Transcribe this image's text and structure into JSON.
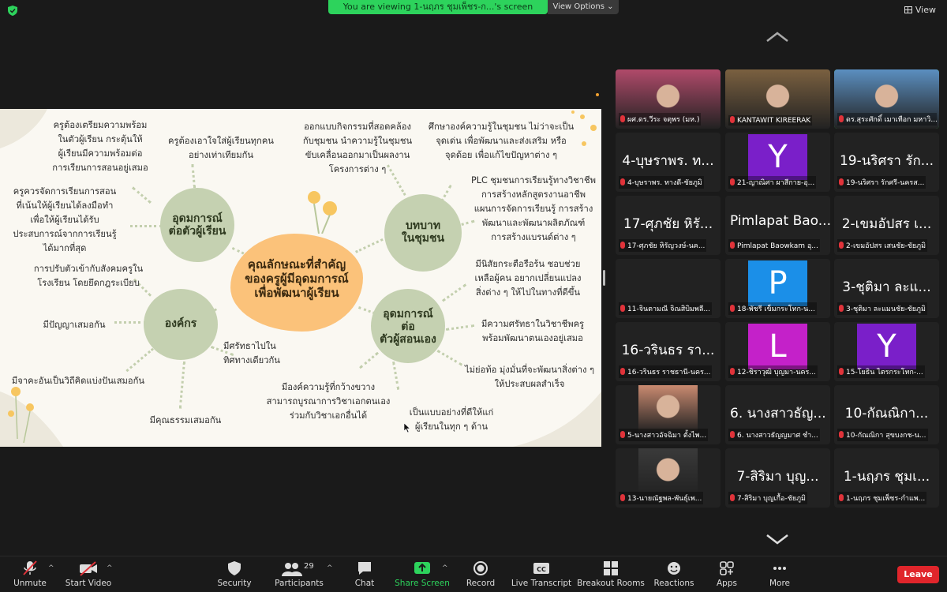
{
  "topbar": {
    "banner": "You are viewing 1-นฤภร ชุมเพ็ชร-ก...'s screen",
    "view_options": "View Options ⌄",
    "view": "View"
  },
  "slide": {
    "center": "คุณลักษณะที่สำคัญ\nของครูผู้มีอุดมการณ์\nเพื่อพัฒนาผู้เรียน",
    "blob_students": "อุดมการณ์\nต่อตัวผู้เรียน",
    "blob_community": "บทบาท\nในชุมชน",
    "blob_org": "องค์กร",
    "blob_self": "อุดมการณ์\nต่อ\nตัวผู้สอนเอง",
    "t1": "ครูต้องเตรียมความพร้อม\nในตัวผู้เรียน กระตุ้นให้\nผู้เรียนมีความพร้อมต่อ\nการเรียนการสอนอยู่เสมอ",
    "t2": "ครูต้องเอาใจใส่ผู้เรียนทุกคน\nอย่างเท่าเทียมกัน",
    "t3": "ครูควรจัดการเรียนการสอน\nที่เน้นให้ผู้เรียนได้ลงมือทำ\nเพื่อให้ผู้เรียนได้รับ\nประสบการณ์จากการเรียนรู้\nได้มากที่สุด",
    "t4": "ออกแบบกิจกรรมที่สอดคล้อง\nกับชุมชน นำความรู้ในชุมชน\nขับเคลื่อนออกมาเป็นผลงาน\nโครงการต่าง ๆ",
    "t5": "ศึกษาองค์ความรู้ในชุมชน ไม่ว่าจะเป็น\nจุดเด่น เพื่อพัฒนาและส่งเสริม หรือ\nจุดด้อย เพื่อแก้ไขปัญหาต่าง ๆ",
    "t6": "PLC ชุมชนการเรียนรู้ทางวิชาชีพ\nการสร้างหลักสูตรงานอาชีพ\nแผนการจัดการเรียนรู้ การสร้าง\nพัฒนาและพัฒนาผลิตภัณฑ์\nการสร้างแบรนด์ต่าง ๆ",
    "t7": "การปรับตัวเข้ากับสังคมครูใน\nโรงเรียน โดยยึดกฎระเบียบ",
    "t8": "มีปัญญาเสมอกัน",
    "t9": "มีศรัทธาไปใน\nทิศทางเดียวกัน",
    "t10": "มีจาคะอันเป็นวิถีคิดแบ่งปันเสมอกัน",
    "t11": "มีคุณธรรมเสมอกัน",
    "t12": "มีองค์ความรู้ที่กว้างขวาง\nสามารถบูรณาการวิชาเอกตนเอง\nร่วมกับวิชาเอกอื่นได้",
    "t13": "มีนิสัยกระตือรือร้น ชอบช่วย\nเหลือผู้คน อยากเปลี่ยนแปลง\nสิ่งต่าง ๆ ให้ไปในทางที่ดีขึ้น",
    "t14": "มีความศรัทธาในวิชาชีพครู\nพร้อมพัฒนาตนเองอยู่เสมอ",
    "t15": "ไม่ย่อท้อ มุ่งมั่นที่จะพัฒนาสิ่งต่าง ๆ\nให้ประสบผลสำเร็จ",
    "t16": "เป็นแบบอย่างที่ดีให้แก่\nผู้เรียนในทุก ๆ ด้าน"
  },
  "tiles": [
    {
      "big": "",
      "name": "ผศ.ดร.วีระ จตุพร (มห.)",
      "kind": "video",
      "color": "#b04a6a"
    },
    {
      "big": "",
      "name": "KANTAWIT KIREERAK",
      "kind": "video",
      "color": "#7a6040"
    },
    {
      "big": "",
      "name": "ดร.สุระศักดิ์ เมาเทือก มหาวิ...",
      "kind": "video",
      "color": "#5b8fc0"
    },
    {
      "big": "4-บุษราพร. ท...",
      "name": "4-บุษราพร. ทางดี-ชัยภูมิ",
      "kind": "text"
    },
    {
      "big": "Y",
      "name": "21-ญาณิศา ผาสีกาย-อุ...",
      "kind": "avatar",
      "color": "#7a1fc9"
    },
    {
      "big": "19-นริศรา รัก...",
      "name": "19-นริศรา รักศรี-นครส...",
      "kind": "text"
    },
    {
      "big": "17-ศุภชัย หิรั...",
      "name": "17-ศุภชัย หิรัญวงษ์-นค...",
      "kind": "text"
    },
    {
      "big": "Pimlapat Bao...",
      "name": "Pimlapat Baowkam อุ...",
      "kind": "text"
    },
    {
      "big": "2-เขมอัปสร เ...",
      "name": "2-เขมอัปสร เสนชัย-ชัยภูมิ",
      "kind": "text"
    },
    {
      "big": "",
      "name": "11-จินตามณี จิณสิบิมพลี...",
      "kind": "blank"
    },
    {
      "big": "P",
      "name": "18-พัชรี เข็มกระโทก-น...",
      "kind": "avatar",
      "color": "#1b8fe8"
    },
    {
      "big": "3-ชุติมา ละแ...",
      "name": "3-ชุติมา ละแมนชัย-ชัยภูมิ",
      "kind": "text"
    },
    {
      "big": "16-วรินธร รา...",
      "name": "16-วรินธร ราชธานี-นคร...",
      "kind": "text"
    },
    {
      "big": "L",
      "name": "12-ชิราวุฒิ บุญมา-นคร...",
      "kind": "avatar",
      "color": "#c421c9"
    },
    {
      "big": "Y",
      "name": "15-โยธิน ไตรกระโทก-...",
      "kind": "avatar",
      "color": "#7a1fc9"
    },
    {
      "big": "",
      "name": "5-นางสาวอัจฉิมา ตั้งไพ...",
      "kind": "video",
      "color": "#c98a70"
    },
    {
      "big": "6. นางสาวธัญ...",
      "name": "6. นางสาวธัญญมาศ ชำ...",
      "kind": "text"
    },
    {
      "big": "10-กัณณิกา...",
      "name": "10-กัณณิกา สุขบงกช-น...",
      "kind": "text"
    },
    {
      "big": "",
      "name": "13-นายณัฐพล-พันธุ์เพ...",
      "kind": "video",
      "color": "#3a3a3a"
    },
    {
      "big": "7-สิริมา บุญ...",
      "name": "7-สิริมา บุญเกื้อ-ชัยภูมิ",
      "kind": "text"
    },
    {
      "big": "1-นฤภร ชุมเ...",
      "name": "1-นฤภร ชุมเพ็ชร-กำแพ...",
      "kind": "text"
    }
  ],
  "toolbar": {
    "unmute": "Unmute",
    "start_video": "Start Video",
    "security": "Security",
    "participants": "Participants",
    "participants_count": "29",
    "chat": "Chat",
    "share_screen": "Share Screen",
    "record": "Record",
    "live_transcript": "Live Transcript",
    "breakout_rooms": "Breakout Rooms",
    "reactions": "Reactions",
    "apps": "Apps",
    "more": "More",
    "leave": "Leave"
  },
  "colors": {
    "accent_green": "#2dd35c",
    "leave_red": "#e0252b",
    "blob_green": "#c5d1b1",
    "blob_orange": "#fbc27a"
  }
}
